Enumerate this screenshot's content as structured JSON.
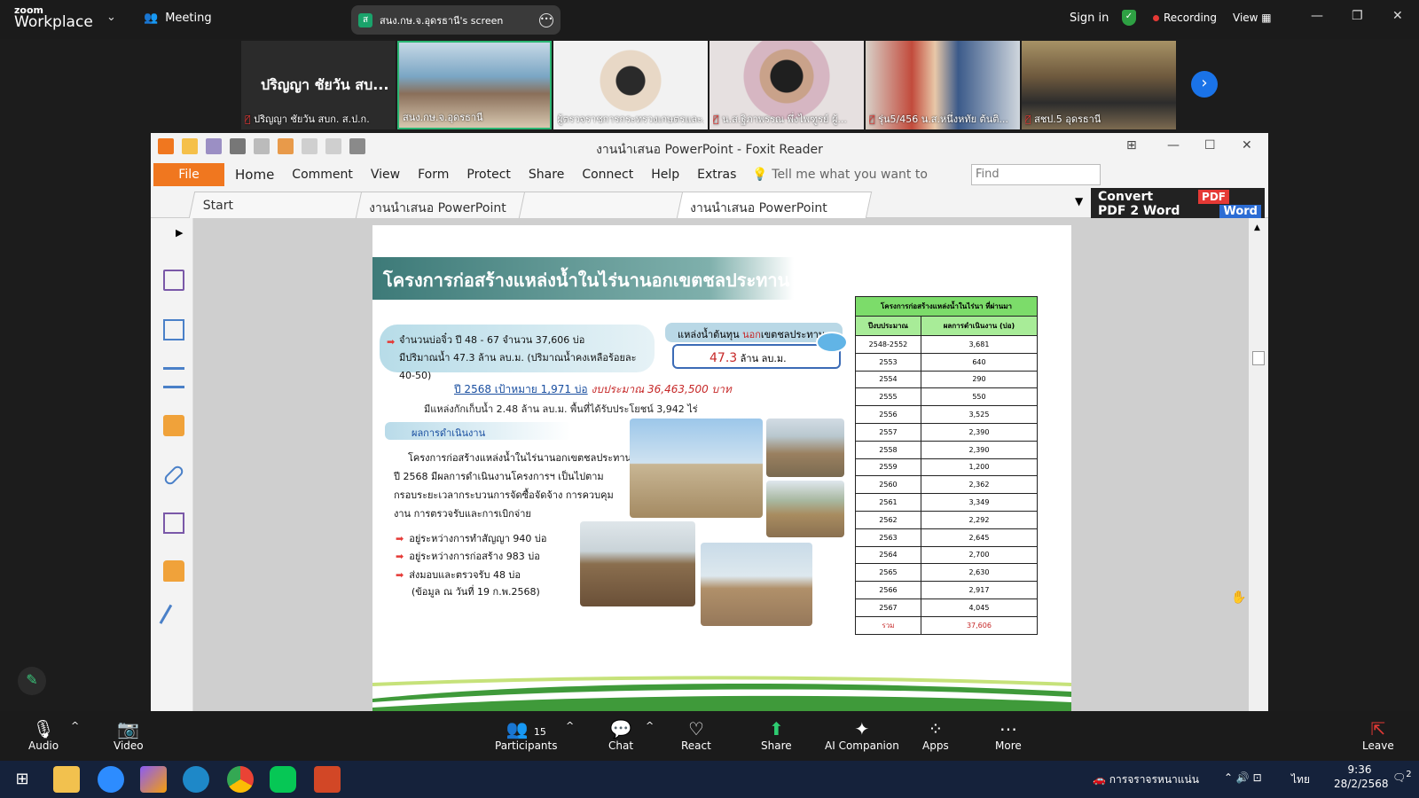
{
  "zoom": {
    "logo_small": "zoom",
    "logo_big": "Workplace",
    "meeting_label": "Meeting",
    "share_label": "สนง.กษ.จ.อุดรธานี's screen",
    "share_badge": "ส",
    "signin": "Sign in",
    "recording": "Recording",
    "view": "View",
    "participants": [
      {
        "name": "ปริญญา ชัยวัน สบก. ส.ป.ก.",
        "big": "ปริญญา ชัยวัน สบ..."
      },
      {
        "name": "สนง.กษ.จ.อุดรธานี"
      },
      {
        "name": "ผู้ตรวจราชการกระทรวงเกษตรและ..."
      },
      {
        "name": "น.ส.ฐิภาพรรณ พึ่งไพฑูรย์ ผู้..."
      },
      {
        "name": "รุ่น5/456 น.ส.หนึ่งหทัย ต้นติ..."
      },
      {
        "name": "สชป.5 อุดรธานี"
      }
    ]
  },
  "foxit": {
    "title": "งานนำเสนอ PowerPoint - Foxit Reader",
    "menu": {
      "file": "File",
      "items": [
        "Home",
        "Comment",
        "View",
        "Form",
        "Protect",
        "Share",
        "Connect",
        "Help",
        "Extras"
      ],
      "tellme": "Tell me what you want to",
      "find_placeholder": "Find"
    },
    "tabs": [
      "Start",
      "งานนำเสนอ PowerPoint",
      "งานนำเสนอ PowerPoint"
    ],
    "convert": {
      "line1": "Convert",
      "line2": "PDF 2 Word",
      "pdf": "PDF",
      "word": "Word"
    }
  },
  "slide": {
    "title": "โครงการก่อสร้างแหล่งน้ำในไร่นานอกเขตชลประทาน (พด.)",
    "box1_line1": "จำนวนบ่อจิ๋ว ปี 48 - 67  จำนวน 37,606 บ่อ",
    "box1_line2": "มีปริมาณน้ำ 47.3 ล้าน ลบ.ม. (ปริมาณน้ำคงเหลือร้อยละ 40-50)",
    "box2_label_a": "แหล่งน้ำต้นทุน ",
    "box2_label_red": "นอก",
    "box2_label_b": "เขตชลประทาน",
    "box2_num": "47.3",
    "box2_unit": " ล้าน ลบ.ม.",
    "target_a": "ปี 2568 เป้าหมาย 1,971 บ่อ",
    "target_b": "  งบประมาณ 36,463,500 บาท",
    "source": "มีแหล่งกักเก็บน้ำ 2.48 ล้าน ลบ.ม. พื้นที่ได้รับประโยชน์ 3,942 ไร่",
    "results_heading": "ผลการดำเนินงาน",
    "body_lines": [
      "โครงการก่อสร้างแหล่งน้ำในไร่นานอกเขตชลประทาน",
      "ปี 2568  มีผลการดำเนินงานโครงการฯ เป็นไปตาม",
      "กรอบระยะเวลากระบวนการจัดซื้อจัดจ้าง การควบคุม",
      "งาน การตรวจรับและการเบิกจ่าย"
    ],
    "bullets": [
      "อยู่ระหว่างการทำสัญญา 940 บ่อ",
      "อยู่ระหว่างการก่อสร้าง 983 บ่อ",
      "ส่งมอบและตรวจรับ  48 บ่อ"
    ],
    "note": "(ข้อมูล ณ วันที่ 19 ก.พ.2568)",
    "table": {
      "caption": "โครงการก่อสร้างแหล่งน้ำในไร่นา ที่ผ่านมา",
      "col1": "ปีงบประมาณ",
      "col2": "ผลการดำเนินงาน (บ่อ)",
      "rows": [
        [
          "2548-2552",
          "3,681"
        ],
        [
          "2553",
          "640"
        ],
        [
          "2554",
          "290"
        ],
        [
          "2555",
          "550"
        ],
        [
          "2556",
          "3,525"
        ],
        [
          "2557",
          "2,390"
        ],
        [
          "2558",
          "2,390"
        ],
        [
          "2559",
          "1,200"
        ],
        [
          "2560",
          "2,362"
        ],
        [
          "2561",
          "3,349"
        ],
        [
          "2562",
          "2,292"
        ],
        [
          "2563",
          "2,645"
        ],
        [
          "2564",
          "2,700"
        ],
        [
          "2565",
          "2,630"
        ],
        [
          "2566",
          "2,917"
        ],
        [
          "2567",
          "4,045"
        ]
      ],
      "total_label": "รวม",
      "total_value": "37,606"
    }
  },
  "toolbar": {
    "audio": "Audio",
    "video": "Video",
    "participants": "Participants",
    "participants_count": "15",
    "chat": "Chat",
    "react": "React",
    "share": "Share",
    "ai": "AI Companion",
    "apps": "Apps",
    "more": "More",
    "leave": "Leave"
  },
  "taskbar": {
    "notification": "การจราจรหนาแน่น",
    "lang": "ไทย",
    "time": "9:36",
    "date": "28/2/2568",
    "badge": "2"
  }
}
